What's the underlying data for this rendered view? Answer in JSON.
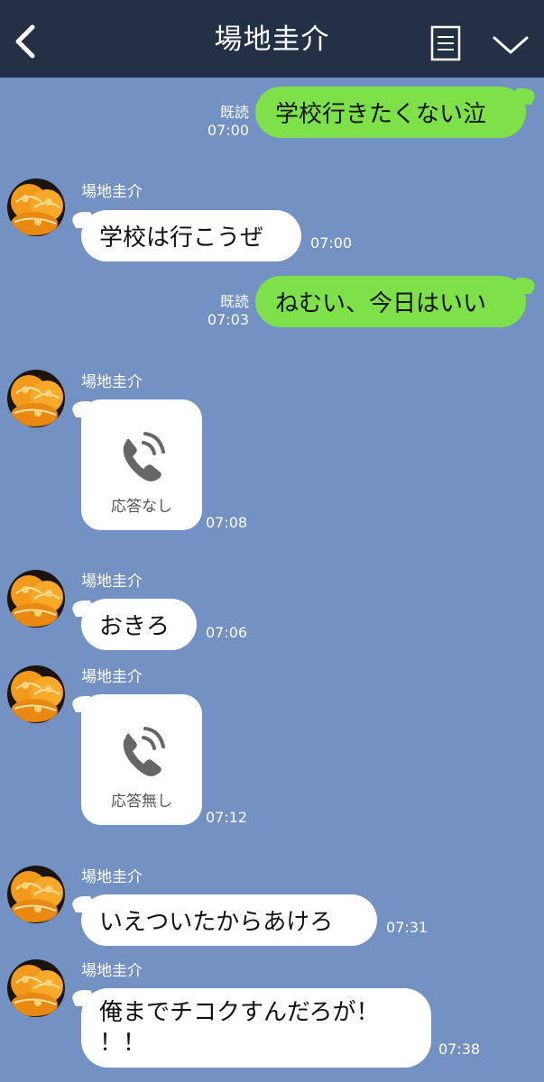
{
  "header": {
    "title": "場地圭介",
    "back_icon": "chevron-left-icon",
    "notes_icon": "notes-icon",
    "menu_icon": "chevron-down-icon",
    "bg_color": "#233046"
  },
  "colors": {
    "background": "#7391c2",
    "sent_bubble": "#7ee149",
    "received_bubble": "#ffffff"
  },
  "messages": [
    {
      "kind": "sent",
      "text": "学校行きたくない泣",
      "read": "既読",
      "time": "07:00"
    },
    {
      "kind": "received",
      "sender": "場地圭介",
      "text": "学校は行こうぜ",
      "time": "07:00"
    },
    {
      "kind": "sent",
      "text": "ねむい、今日はいい",
      "read": "既読",
      "time": "07:03"
    },
    {
      "kind": "call",
      "sender": "場地圭介",
      "label": "応答なし",
      "time": "07:08"
    },
    {
      "kind": "received",
      "sender": "場地圭介",
      "text": "おきろ",
      "time": "07:06"
    },
    {
      "kind": "call",
      "sender": "場地圭介",
      "label": "応答無し",
      "time": "07:12"
    },
    {
      "kind": "received",
      "sender": "場地圭介",
      "text": "いえついたからあけろ",
      "time": "07:31"
    },
    {
      "kind": "received",
      "sender": "場地圭介",
      "text_lines": [
        "俺までチコクすんだろが！",
        "！！"
      ],
      "time": "07:38"
    }
  ]
}
